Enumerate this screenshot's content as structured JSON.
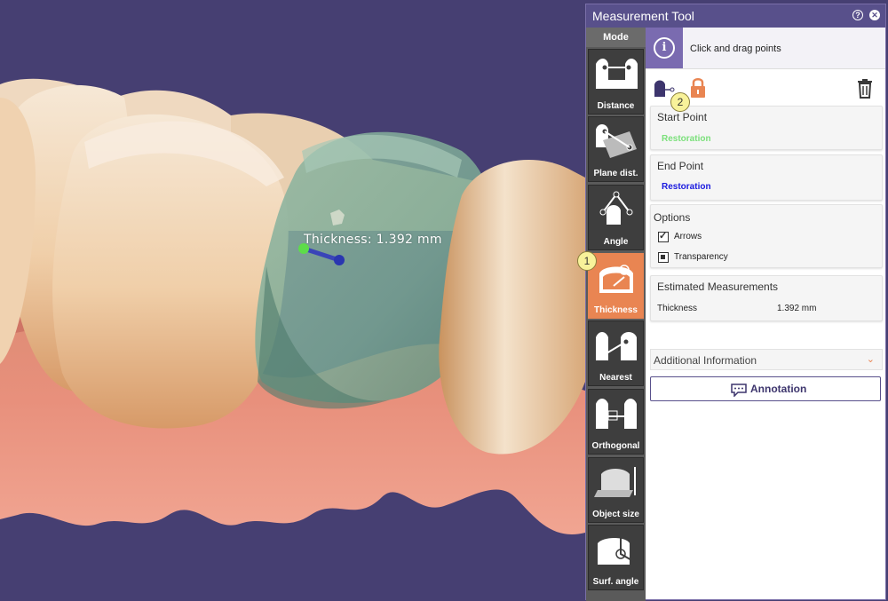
{
  "viewport": {
    "measurement_label": "Thickness: 1.392 mm"
  },
  "panel": {
    "title": "Measurement Tool",
    "help_icon": "?",
    "close_icon": "✕",
    "mode_header": "Mode",
    "modes": [
      {
        "label": "Distance",
        "icon": "distance-icon",
        "active": false
      },
      {
        "label": "Plane dist.",
        "icon": "plane-distance-icon",
        "active": false
      },
      {
        "label": "Angle",
        "icon": "angle-icon",
        "active": false
      },
      {
        "label": "Thickness",
        "icon": "thickness-icon",
        "active": true
      },
      {
        "label": "Nearest",
        "icon": "nearest-icon",
        "active": false
      },
      {
        "label": "Orthogonal",
        "icon": "orthogonal-icon",
        "active": false
      },
      {
        "label": "Object size",
        "icon": "object-size-icon",
        "active": false
      },
      {
        "label": "Surf. angle",
        "icon": "surface-angle-icon",
        "active": false
      }
    ],
    "info_text": "Click and drag points",
    "start_point": {
      "label": "Start Point",
      "value": "Restoration",
      "color": "#7be07b"
    },
    "end_point": {
      "label": "End Point",
      "value": "Restoration",
      "color": "#1a1adf"
    },
    "options": {
      "label": "Options",
      "arrows": "Arrows",
      "transparency": "Transparency"
    },
    "estimated": {
      "label": "Estimated Measurements",
      "name": "Thickness",
      "value": "1.392 mm"
    },
    "additional_info": "Additional Information",
    "annotation": "Annotation",
    "badges": [
      "1",
      "2"
    ]
  },
  "colors": {
    "background": "#463f72",
    "panel_header": "#58508b",
    "accent": "#e98552"
  }
}
